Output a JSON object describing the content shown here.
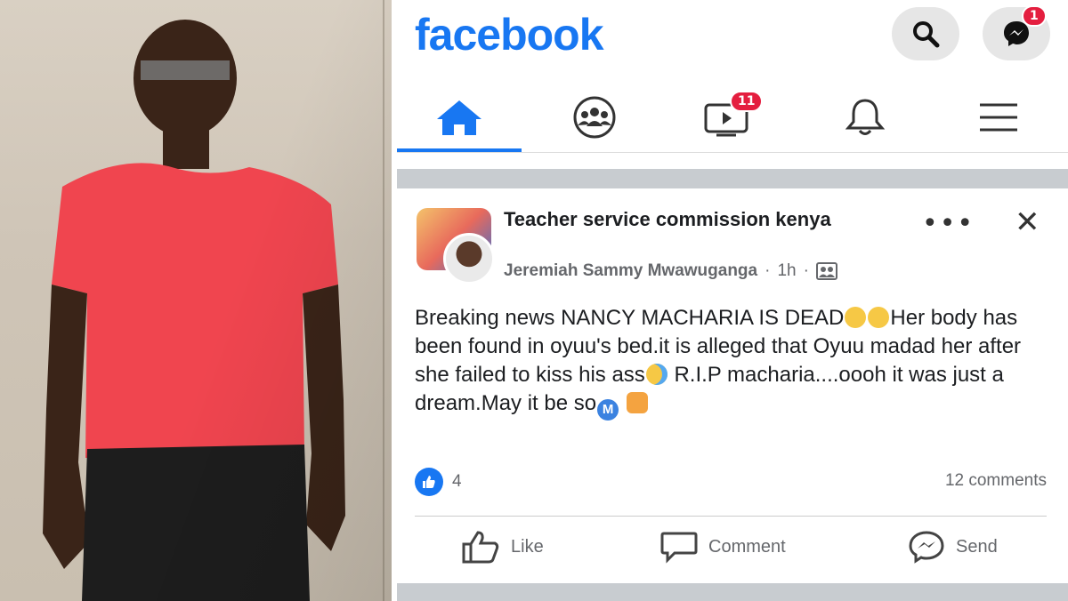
{
  "header": {
    "logo_text": "facebook",
    "messenger_badge": "1"
  },
  "nav": {
    "video_badge": "11"
  },
  "post": {
    "group_name": "Teacher service commission kenya",
    "author": "Jeremiah Sammy Mwawuganga",
    "time": "1h",
    "more_label": "•••",
    "close_label": "✕",
    "text_parts": {
      "p1": "Breaking news NANCY MACHARIA IS DEAD",
      "p2": "Her body has been found in oyuu's bed.it is alleged that Oyuu madad her after she failed to kiss his ass",
      "p3": "R.I.P macharia....oooh it was just a dream.May it be so",
      "m_emoji": "M"
    },
    "reaction_count": "4",
    "comments_count": "12 comments"
  },
  "actions": {
    "like_label": "Like",
    "comment_label": "Comment",
    "send_label": "Send"
  },
  "colors": {
    "brand": "#1877f2",
    "badge": "#e41e3f",
    "secondary_text": "#65676b"
  }
}
